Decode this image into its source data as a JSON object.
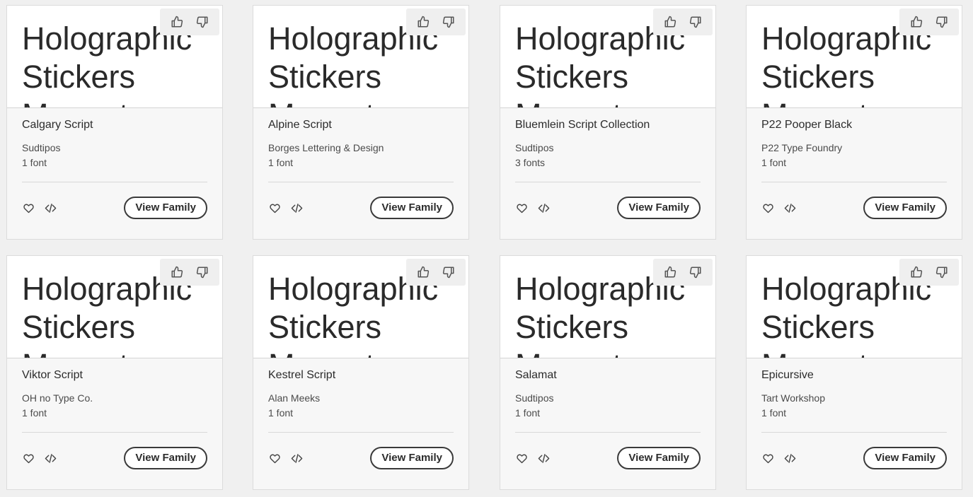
{
  "preview_text": "Holographic Stickers Magenta",
  "view_label": "View Family",
  "cards": [
    {
      "name": "Calgary Script",
      "foundry": "Sudtipos",
      "count": "1 font"
    },
    {
      "name": "Alpine Script",
      "foundry": "Borges Lettering & Design",
      "count": "1 font"
    },
    {
      "name": "Bluemlein Script Collection",
      "foundry": "Sudtipos",
      "count": "3 fonts"
    },
    {
      "name": "P22 Pooper Black",
      "foundry": "P22 Type Foundry",
      "count": "1 font"
    },
    {
      "name": "Viktor Script",
      "foundry": "OH no Type Co.",
      "count": "1 font"
    },
    {
      "name": "Kestrel Script",
      "foundry": "Alan Meeks",
      "count": "1 font"
    },
    {
      "name": "Salamat",
      "foundry": "Sudtipos",
      "count": "1 font"
    },
    {
      "name": "Epicursive",
      "foundry": "Tart Workshop",
      "count": "1 font"
    }
  ],
  "icons": {
    "thumbs_up": "thumbs-up-icon",
    "thumbs_down": "thumbs-down-icon",
    "favorite": "heart-icon",
    "embed": "code-icon"
  },
  "colors": {
    "page_bg": "#f0f0f0",
    "card_bg": "#f7f7f7",
    "preview_bg": "#ffffff",
    "text": "#2c2c2c",
    "button_border": "#3a3a3a"
  }
}
